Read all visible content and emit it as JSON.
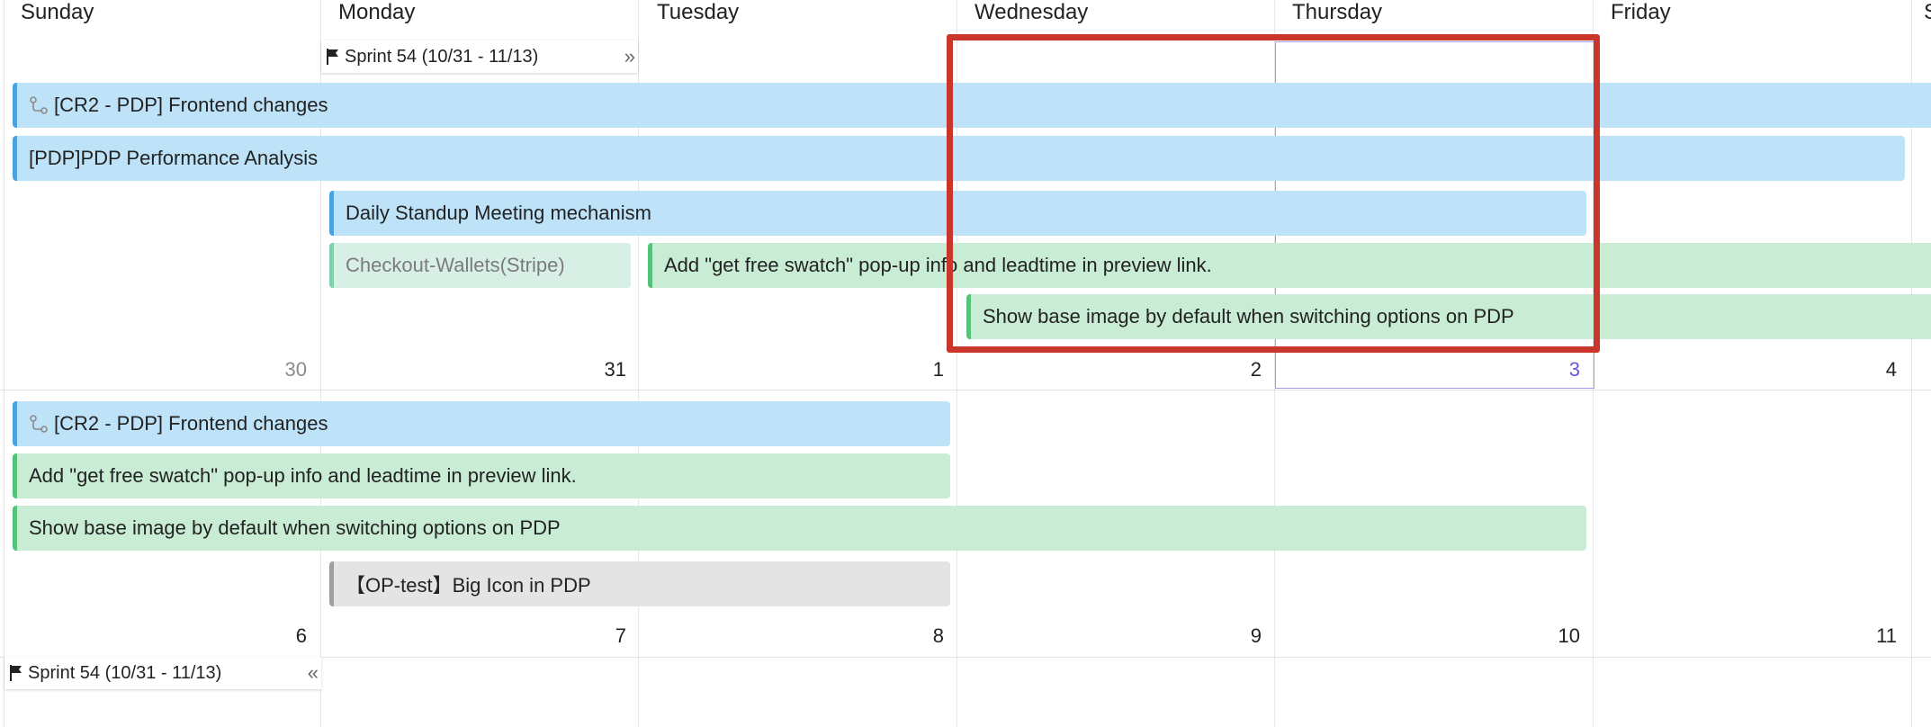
{
  "days": {
    "sunday": "Sunday",
    "monday": "Monday",
    "tuesday": "Tuesday",
    "wednesday": "Wednesday",
    "thursday": "Thursday",
    "friday": "Friday",
    "saturday_partial": "S"
  },
  "week1": {
    "dates": [
      "30",
      "31",
      "1",
      "2",
      "3",
      "4"
    ],
    "sprint": {
      "label": "Sprint 54 (10/31 - 11/13)",
      "arrows": "»"
    },
    "events": {
      "cr2": "[CR2 - PDP] Frontend changes",
      "pdp_perf": "[PDP]PDP Performance Analysis",
      "standup": "Daily Standup Meeting mechanism",
      "wallets": "Checkout-Wallets(Stripe)",
      "swatch": "Add \"get free swatch\" pop-up info and leadtime in preview link.",
      "base_image": "Show base image by default when switching options on PDP"
    }
  },
  "week2": {
    "dates": [
      "6",
      "7",
      "8",
      "9",
      "10",
      "11"
    ],
    "sprint": {
      "label": "Sprint 54 (10/31 - 11/13)",
      "arrows": "«"
    },
    "events": {
      "cr2": "[CR2 - PDP] Frontend changes",
      "swatch": "Add \"get free swatch\" pop-up info and leadtime in preview link.",
      "base_image": "Show base image by default when switching options on PDP",
      "big_icon": "【OP-test】Big Icon in PDP"
    }
  },
  "icons": {
    "event_link": "link-icon",
    "sprint_flag": "flag-icon"
  },
  "colors": {
    "blue_event_bg": "#bee3f8",
    "blue_event_accent": "#4aa3e0",
    "green_event_bg": "#c9ecd5",
    "green_event_accent": "#55c27a",
    "gray_event_bg": "#e4e4e4",
    "today": "#6a55d6",
    "highlight": "#c9362b"
  }
}
